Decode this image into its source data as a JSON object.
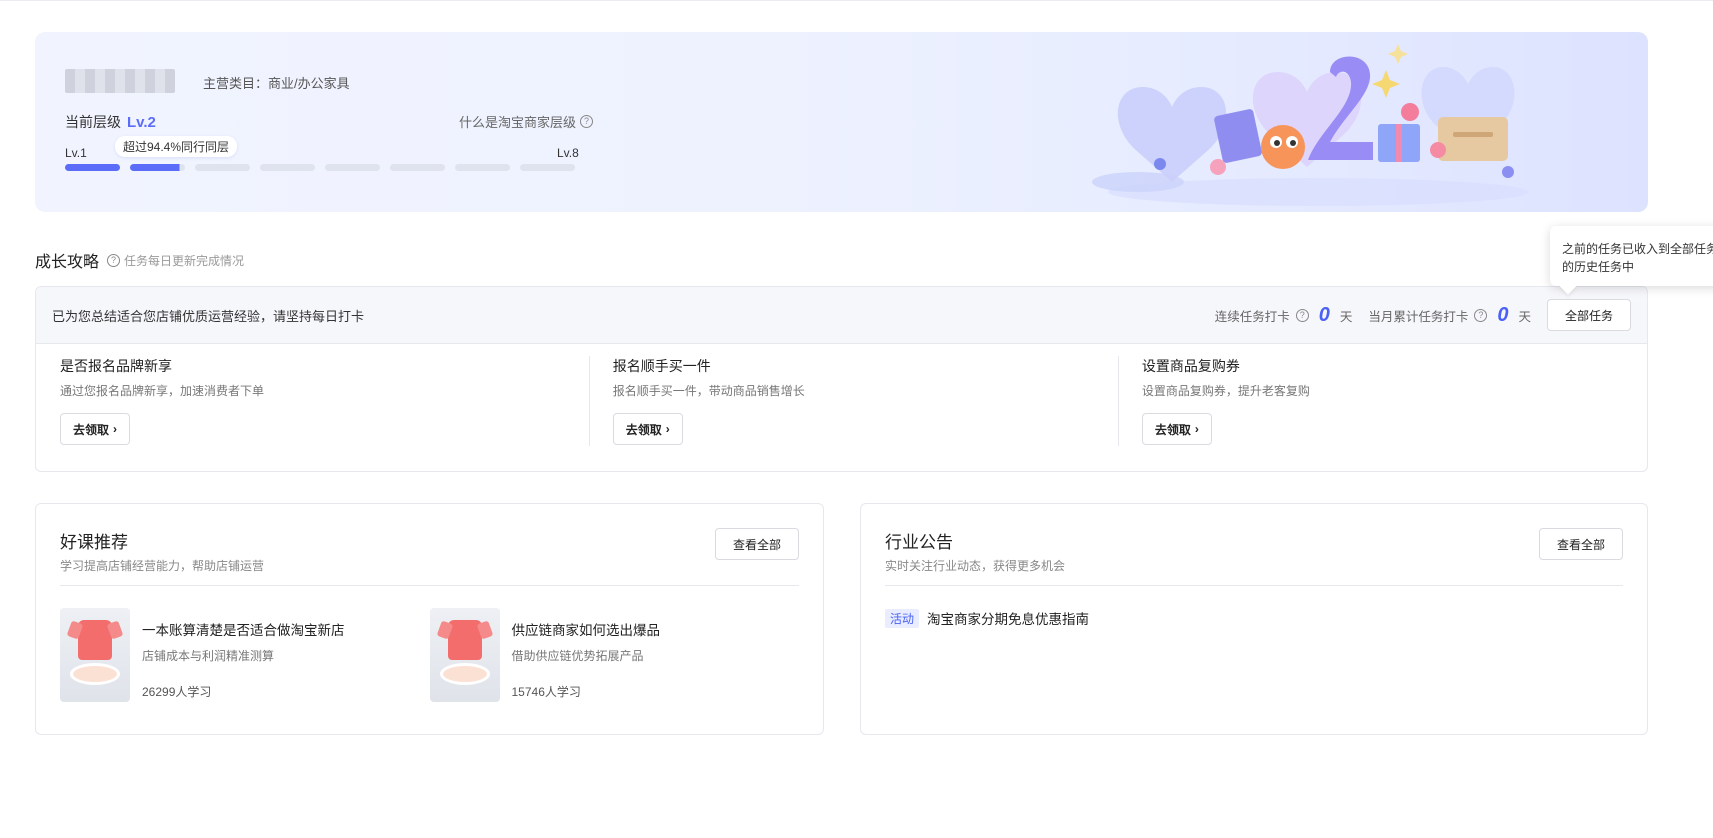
{
  "banner": {
    "category": "主营类目：商业/办公家具",
    "level_label": "当前层级",
    "level_value": "Lv.2",
    "help_link": "什么是淘宝商家层级",
    "level_start": "Lv.1",
    "level_end": "Lv.8",
    "progress_bubble": "超过94.4%同行同层",
    "segments_total": 8,
    "segments_completed": 1,
    "current_segment_progress": 0.9
  },
  "growth": {
    "title": "成长攻略",
    "subtitle": "任务每日更新完成情况",
    "tooltip": "之前的任务已收入到全部任务的历史任务中",
    "notice": "已为您总结适合您店铺优质运营经验，请坚持每日打卡",
    "streak_label": "连续任务打卡",
    "streak_value": "0",
    "streak_unit": "天",
    "monthly_label": "当月累计任务打卡",
    "monthly_value": "0",
    "monthly_unit": "天",
    "all_tasks_label": "全部任务",
    "tasks": [
      {
        "name": "是否报名品牌新享",
        "desc": "通过您报名品牌新享，加速消费者下单",
        "button": "去领取"
      },
      {
        "name": "报名顺手买一件",
        "desc": "报名顺手买一件，带动商品销售增长",
        "button": "去领取"
      },
      {
        "name": "设置商品复购券",
        "desc": "设置商品复购券，提升老客复购",
        "button": "去领取"
      }
    ]
  },
  "courses": {
    "title": "好课推荐",
    "subtitle": "学习提高店铺经营能力，帮助店铺运营",
    "view_all": "查看全部",
    "items": [
      {
        "title": "一本账算清楚是否适合做淘宝新店",
        "sub": "店铺成本与利润精准测算",
        "count": "26299人学习"
      },
      {
        "title": "供应链商家如何选出爆品",
        "sub": "借助供应链优势拓展产品",
        "count": "15746人学习"
      }
    ]
  },
  "news": {
    "title": "行业公告",
    "subtitle": "实时关注行业动态，获得更多机会",
    "view_all": "查看全部",
    "items": [
      {
        "tag": "活动",
        "text": "淘宝商家分期免息优惠指南"
      }
    ]
  },
  "colors": {
    "accent": "#5b6cf9",
    "number_blue": "#4b61f5"
  }
}
